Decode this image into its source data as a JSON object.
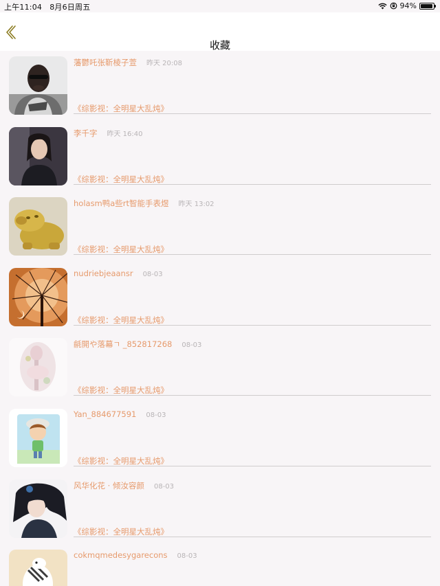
{
  "status_bar": {
    "time": "上午11:04",
    "date": "8月6日周五",
    "battery": "94%",
    "battery_level": 0.94
  },
  "nav": {
    "title": "收藏",
    "back_icon": "chevron-left-icon"
  },
  "items": [
    {
      "user": "藩鬱吒张靳棱子萱",
      "time": "昨天 20:08",
      "title": "《综影视：全明星大乱炖》",
      "avatar_desc": "man-portrait-photo"
    },
    {
      "user": "李千字",
      "time": "昨天 16:40",
      "title": "《综影视：全明星大乱炖》",
      "avatar_desc": "costume-portrait-photo"
    },
    {
      "user": "holasm鸭a些rt智能手表煜",
      "time": "昨天 13:02",
      "title": "《综影视：全明星大乱炖》",
      "avatar_desc": "golden-statue-photo"
    },
    {
      "user": "nudriebjeaansr",
      "time": "08-03",
      "title": "《综影视：全明星大乱炖》",
      "avatar_desc": "dandelion-photo"
    },
    {
      "user": "毹開や落幕ㄱ _852817268",
      "time": "08-03",
      "title": "《综影视：全明星大乱炖》",
      "avatar_desc": "pale-figure-image"
    },
    {
      "user": "Yan_884677591",
      "time": "08-03",
      "title": "《综影视：全明星大乱炖》",
      "avatar_desc": "cartoon-kid-image"
    },
    {
      "user": "风华化花 · 倾汝容颜",
      "time": "08-03",
      "title": "《综影视：全明星大乱炖》",
      "avatar_desc": "anime-character-image"
    },
    {
      "user": "cokmqmedesygarecons",
      "time": "08-03",
      "title": "",
      "avatar_desc": "cartoon-animal-image"
    }
  ]
}
